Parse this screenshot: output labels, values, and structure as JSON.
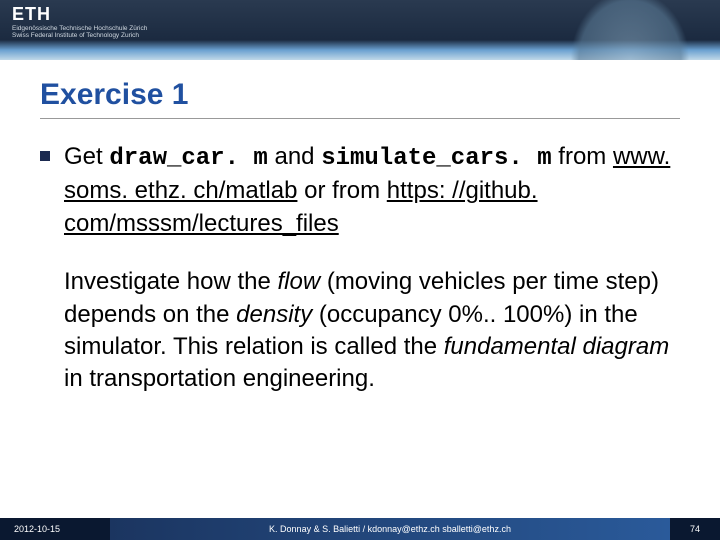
{
  "header": {
    "logo": "ETH",
    "sub1": "Eidgenössische Technische Hochschule Zürich",
    "sub2": "Swiss Federal Institute of Technology Zurich"
  },
  "title": "Exercise 1",
  "bullet": {
    "t1": "Get ",
    "code1": "draw_car. m",
    "t2": " and ",
    "code2": "simulate_cars. m",
    "t3": " from ",
    "link1": "www. soms. ethz. ch/matlab",
    "t4": " or from ",
    "link2": "https: //github. com/msssm/lectures_files"
  },
  "para": {
    "p1": "Investigate how the ",
    "em1": "flow",
    "p2": " (moving vehicles per time step) depends on the ",
    "em2": "density",
    "p3": " (occupancy 0%.. 100%) in the simulator. This relation is called the ",
    "em3": "fundamental diagram",
    "p4": " in transportation engineering."
  },
  "footer": {
    "date": "2012-10-15",
    "authors": "K. Donnay & S. Balietti / kdonnay@ethz.ch sballetti@ethz.ch",
    "page": "74"
  }
}
